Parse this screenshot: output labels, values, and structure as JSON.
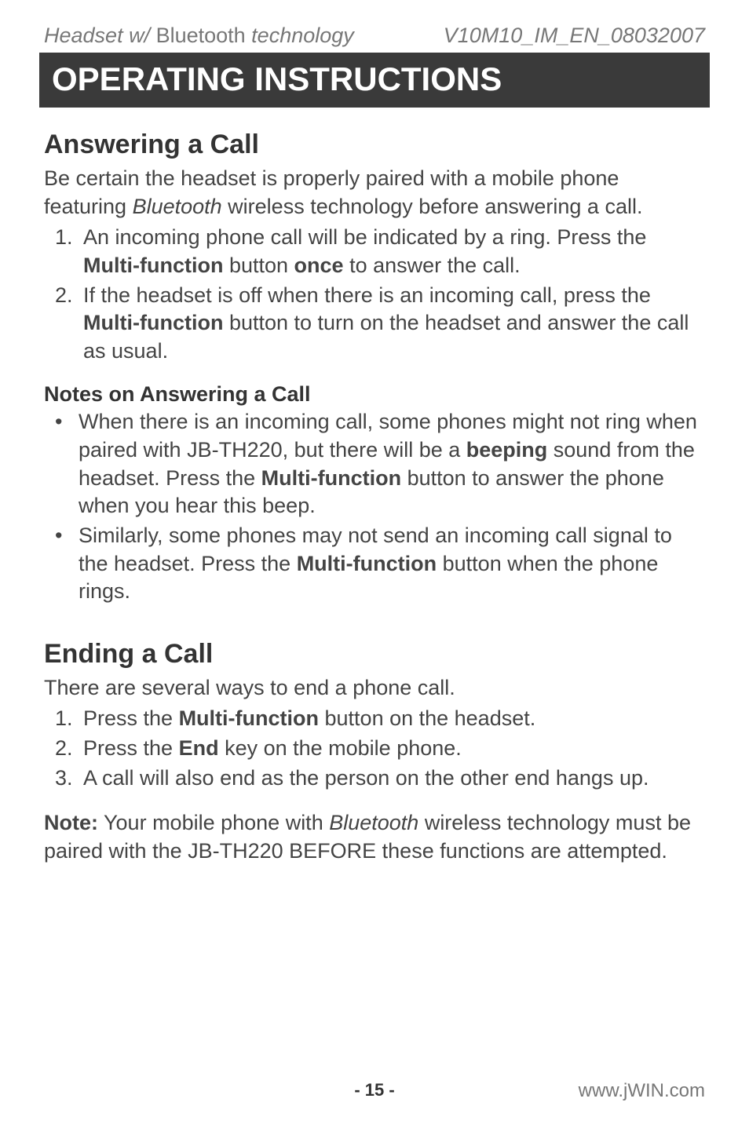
{
  "header": {
    "left_pre": "Headset w/ ",
    "left_bt": "Bluetooth",
    "left_post": " technology",
    "right": "V10M10_IM_EN_08032007"
  },
  "banner": "OPERATING INSTRUCTIONS",
  "answering": {
    "title": "Answering a Call",
    "intro_pre": "Be certain the headset is properly paired with a mobile phone featuring ",
    "intro_bt": "Bluetooth",
    "intro_post": " wireless technology before answering a call.",
    "steps": {
      "s1_pre": "An incoming phone call will be indicated by a ring. Press the ",
      "s1_b1": "Multi-function",
      "s1_mid": " button ",
      "s1_b2": "once",
      "s1_post": " to answer the call.",
      "s2_pre": "If the headset is off when there is an incoming call, press the ",
      "s2_b1": "Multi-function",
      "s2_post": " button to turn on the headset and answer the call as usual."
    }
  },
  "notes": {
    "title": "Notes on Answering a Call",
    "n1_pre": "When there is an incoming call, some phones might not ring when paired with JB-TH220, but there will be a ",
    "n1_b1": "beeping",
    "n1_mid": " sound from the headset. Press the ",
    "n1_b2": "Multi-function",
    "n1_post": " button to answer the phone when you hear this beep.",
    "n2_pre": "Similarly, some phones may not send an incoming call signal to the headset. Press the ",
    "n2_b1": "Multi-function",
    "n2_post": " button when the phone rings."
  },
  "ending": {
    "title": "Ending a Call",
    "intro": "There are several ways to end a phone call.",
    "steps": {
      "s1_pre": "Press the ",
      "s1_b1": "Multi-function",
      "s1_post": " button on the headset.",
      "s2_pre": "Press the ",
      "s2_b1": "End",
      "s2_post": " key on the mobile phone.",
      "s3": "A call will also end as the person on the other end hangs up."
    }
  },
  "note_final": {
    "label": "Note:",
    "pre": " Your mobile phone with ",
    "bt": "Bluetooth",
    "post": " wireless technology must be paired with the JB-TH220 BEFORE these functions are attempted."
  },
  "footer": {
    "page": "- 15 -",
    "site": "www.jWIN.com"
  }
}
